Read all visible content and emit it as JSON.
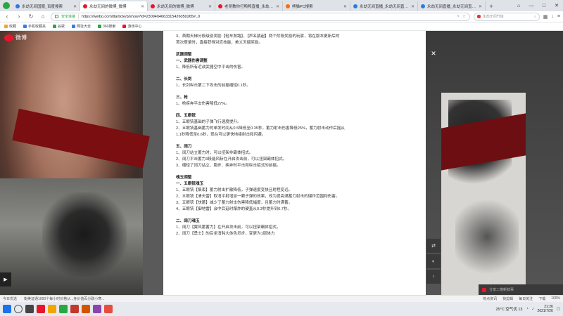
{
  "tabs": [
    {
      "label": "永劫无间国服_百度搜索",
      "icon": "paw-icon",
      "active": false
    },
    {
      "label": "永劫无间的微博_微博",
      "icon": "weibo-icon",
      "active": true
    },
    {
      "label": "永劫无间的微博_微博",
      "icon": "weibo-icon",
      "active": false
    },
    {
      "label": "老吴教你打鸭鸭直播_永劫无间",
      "icon": "weibo-icon",
      "active": false
    },
    {
      "label": "熊猫PC搜索",
      "icon": "box-icon",
      "active": false
    },
    {
      "label": "永劫无间直播_永劫无间直播间",
      "icon": "paw-icon",
      "active": false
    },
    {
      "label": "永劫无间直播_永劫无间直播间",
      "icon": "paw-icon",
      "active": false
    }
  ],
  "new_tab": "+",
  "window_controls": [
    "⌂",
    "—",
    "□",
    "✕"
  ],
  "address": {
    "security_label": "安全连接",
    "url": "https://weibo.com/ttarticle/p/show?id=2309404663315426050265#_0"
  },
  "search": {
    "placeholder": "永劫无间升级"
  },
  "bookmarks": [
    {
      "label": "收藏",
      "icon": "star-icon"
    },
    {
      "label": "手机收藏夹",
      "icon": "phone-icon"
    },
    {
      "label": "谷歌",
      "icon": "google-icon"
    },
    {
      "label": "网址大全",
      "icon": "sites-icon"
    },
    {
      "label": "360搜索",
      "icon": "search-icon"
    },
    {
      "label": "游戏中心",
      "icon": "game-icon"
    }
  ],
  "weibo_logo": "微博",
  "article_lines": [
    {
      "text": "3、首期天梯分段级别奖励【轻车熟路】、【声名鹊起】两个阶段奖励的玩家，将在版本更新后的",
      "bold": false
    },
    {
      "text": "首次登录时，直接获得对应技能、美义天赋奖励。",
      "bold": false
    },
    {
      "text": "",
      "bold": false
    },
    {
      "text": "武器调整",
      "bold": true
    },
    {
      "text": "一、武器伤害调整",
      "bold": true
    },
    {
      "text": "1、降低所有近战武器空中平击的伤害。",
      "bold": false
    },
    {
      "text": "",
      "bold": false
    },
    {
      "text": "二、长剑",
      "bold": true
    },
    {
      "text": "1、长剑纵击第二下攻击的前摇缩短0.1秒。",
      "bold": false
    },
    {
      "text": "",
      "bold": false
    },
    {
      "text": "三、枪",
      "bold": true
    },
    {
      "text": "1、枪疾奔平击伤害降低27%。",
      "bold": false
    },
    {
      "text": "",
      "bold": false
    },
    {
      "text": "四、五眼铳",
      "bold": true
    },
    {
      "text": "1、五眼铳基础的子弹飞行速度提升。",
      "bold": false
    },
    {
      "text": "2、五眼铳基础蓄力的单发时间从0.5降低至0.35秒，蓄力射击伤害降低25%，蓄力射击动作后摇从",
      "bold": false
    },
    {
      "text": "1.1秒降低至0.6秒，现在可以更快地接射击和闪避。",
      "bold": false
    },
    {
      "text": "",
      "bold": false
    },
    {
      "text": "五、阔刀",
      "bold": true
    },
    {
      "text": "1、阔刀站立蓄力时，可以扭架非霸体招式。",
      "bold": false
    },
    {
      "text": "2、阔刀平击蓄力3段能风斩在开启攻击前，可以扭架霸体招式。",
      "bold": false
    },
    {
      "text": "3、缩短了阔刀站立、跑步、疾奔时平击和纵击招式的前摇。",
      "bold": false
    },
    {
      "text": "",
      "bold": false
    },
    {
      "text": "魂玉调整",
      "bold": true
    },
    {
      "text": "一、五眼铳魂玉",
      "bold": true
    },
    {
      "text": "1、五眼铳【集束】蓄力射击扩散降低，子弹速度变快且射程变远。",
      "bold": false
    },
    {
      "text": "2、五眼铳【清天雷】取消平射增加一颗子弹的效果，改为提高满蓄力射击的爆炸范围和伤害。",
      "bold": false
    },
    {
      "text": "3、五眼铳【快蓄】减少了蓄力射击伤害降低幅度，且蓄力时满蓄。",
      "bold": false
    },
    {
      "text": "4、五眼铳【御地雷】会中后延时爆炸的硬直从0.3秒提升到0.7秒。",
      "bold": false
    },
    {
      "text": "",
      "bold": false
    },
    {
      "text": "二、阔刀魂玉",
      "bold": true
    },
    {
      "text": "1、阔刀【翼风蓄蓄力】在开启攻击前，可以扭架霸体招式。",
      "bold": false
    },
    {
      "text": "2、阔刀【勇士】的后坐消耗大体色灵步，变更为1层体力",
      "bold": false
    }
  ],
  "comment_placeholder": "分享二楼新鲜事",
  "status_bar": {
    "left": [
      "今日优选",
      "衡美证通1000个每小时价格从...身价值百分联小寒..."
    ],
    "right": [
      "热点资讯",
      "快剪辑",
      "每日关注",
      "下载",
      "100%"
    ]
  },
  "taskbar": {
    "weather": "25°C 空气优 13",
    "time": "21:26",
    "date": "2021/7/26"
  }
}
